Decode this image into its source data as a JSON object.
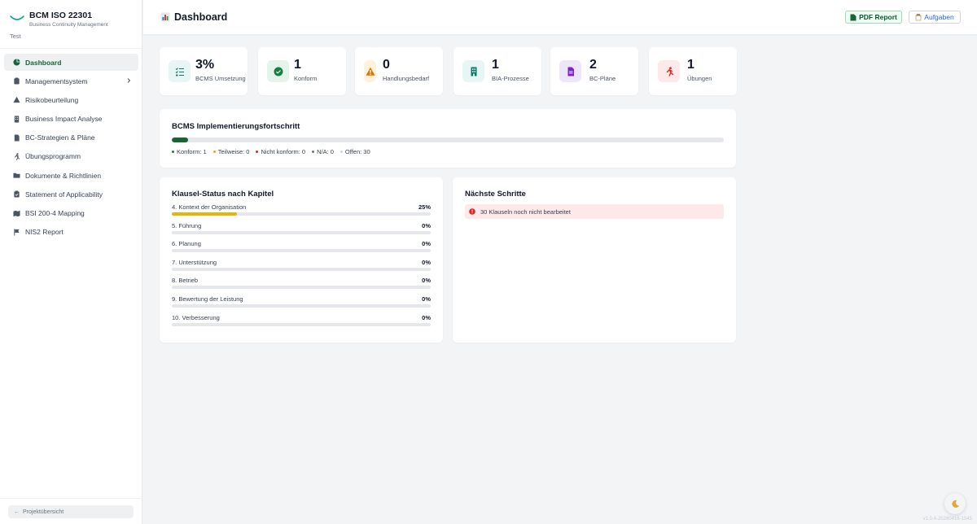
{
  "brand": {
    "title": "BCM ISO 22301",
    "subtitle": "Business Continuity Management",
    "tenant": "Test"
  },
  "sidebar": {
    "items": [
      {
        "label": "Dashboard",
        "icon": "dashboard-icon",
        "active": true
      },
      {
        "label": "Managementsystem",
        "icon": "clipboard-icon",
        "has_submenu": true
      },
      {
        "label": "Risikobeurteilung",
        "icon": "warning-icon"
      },
      {
        "label": "Business Impact Analyse",
        "icon": "building-icon"
      },
      {
        "label": "BC-Strategien & Pläne",
        "icon": "document-icon"
      },
      {
        "label": "Übungsprogramm",
        "icon": "running-icon"
      },
      {
        "label": "Dokumente & Richtlinien",
        "icon": "folder-icon"
      },
      {
        "label": "Statement of Applicability",
        "icon": "clipboard-check-icon"
      },
      {
        "label": "BSI 200-4 Mapping",
        "icon": "map-icon"
      },
      {
        "label": "NIS2 Report",
        "icon": "flag-icon"
      }
    ],
    "footer_label": "Projektübersicht"
  },
  "header": {
    "title": "Dashboard",
    "title_icon": "chart-icon",
    "pdf_label": "PDF Report",
    "tasks_label": "Aufgaben"
  },
  "stats": [
    {
      "value": "3%",
      "label": "BCMS Umsetzung",
      "icon": "checklist-icon",
      "color": "#e6f6f4",
      "icon_color": "#0f766e"
    },
    {
      "value": "1",
      "label": "Konform",
      "icon": "check-circle-icon",
      "color": "#e3f5ea",
      "icon_color": "#15803d"
    },
    {
      "value": "0",
      "label": "Handlungsbedarf",
      "icon": "warning-icon",
      "color": "#fdf3dc",
      "icon_color": "#d97706"
    },
    {
      "value": "1",
      "label": "BIA-Prozesse",
      "icon": "building-icon",
      "color": "#e6f6f4",
      "icon_color": "#0f766e"
    },
    {
      "value": "2",
      "label": "BC-Pläne",
      "icon": "document-icon",
      "color": "#ede5f8",
      "icon_color": "#7e22ce"
    },
    {
      "value": "1",
      "label": "Übungen",
      "icon": "running-icon",
      "color": "#fde8ea",
      "icon_color": "#dc2626"
    }
  ],
  "progress": {
    "title": "BCMS Implementierungsfortschritt",
    "fill_fraction": 0.03,
    "fill_color": "#166534",
    "legend": [
      {
        "label": "Konform: 1",
        "color": "#15803d"
      },
      {
        "label": "Teilweise: 0",
        "color": "#f59e0b"
      },
      {
        "label": "Nicht konform: 0",
        "color": "#dc2626"
      },
      {
        "label": "N/A: 0",
        "color": "#6b7280"
      },
      {
        "label": "Offen: 30",
        "color": "#d1d5db"
      }
    ]
  },
  "clauses": {
    "title": "Klausel-Status nach Kapitel",
    "fill_color": "#eab308",
    "rows": [
      {
        "label": "4. Kontext der Organisation",
        "percent": "25%",
        "value": 0.25
      },
      {
        "label": "5. Führung",
        "percent": "0%",
        "value": 0
      },
      {
        "label": "6. Planung",
        "percent": "0%",
        "value": 0
      },
      {
        "label": "7. Unterstützung",
        "percent": "0%",
        "value": 0
      },
      {
        "label": "8. Betrieb",
        "percent": "0%",
        "value": 0
      },
      {
        "label": "9. Bewertung der Leistung",
        "percent": "0%",
        "value": 0
      },
      {
        "label": "10. Verbesserung",
        "percent": "0%",
        "value": 0
      }
    ]
  },
  "next_steps": {
    "title": "Nächste Schritte",
    "alert": "30 Klauseln noch nicht bearbeitet"
  },
  "version": "v1.0.4-20260416-1545"
}
